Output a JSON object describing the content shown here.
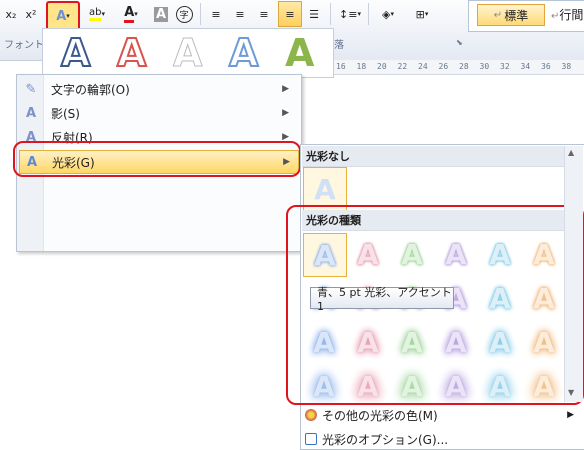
{
  "ribbon": {
    "subscript_label": "x₂",
    "superscript_label": "x²",
    "text_effect_glyph": "A",
    "highlight_glyph": "ab",
    "font_color_glyph": "A",
    "char_shading_glyph": "A",
    "enclosed_char_glyph": "字",
    "group_font_label": "フォント",
    "group_paragraph_label": "落",
    "style_normal_label": "標準",
    "style_next_label": "行間",
    "accent_color": "#e5a43b"
  },
  "ruler": {
    "ticks": [
      "16",
      "18",
      "20",
      "22",
      "24",
      "26",
      "28",
      "30",
      "32",
      "34",
      "36",
      "38"
    ]
  },
  "effects_gallery": {
    "letters": [
      "A",
      "A",
      "A",
      "A",
      "A"
    ]
  },
  "menu": {
    "items": [
      {
        "label": "文字の輪郭(O)",
        "icon": "pen-outline-icon"
      },
      {
        "label": "影(S)",
        "icon": "shadow-A-icon"
      },
      {
        "label": "反射(R)",
        "icon": "reflection-A-icon"
      },
      {
        "label": "光彩(G)",
        "icon": "glow-A-icon"
      }
    ]
  },
  "submenu": {
    "no_glow_heading": "光彩なし",
    "glow_types_heading": "光彩の種類",
    "cell_glyph": "A",
    "tooltip": "青、5 pt 光彩、アクセント 1",
    "more_colors_label": "その他の光彩の色(M)",
    "options_label": "光彩のオプション(G)..."
  }
}
